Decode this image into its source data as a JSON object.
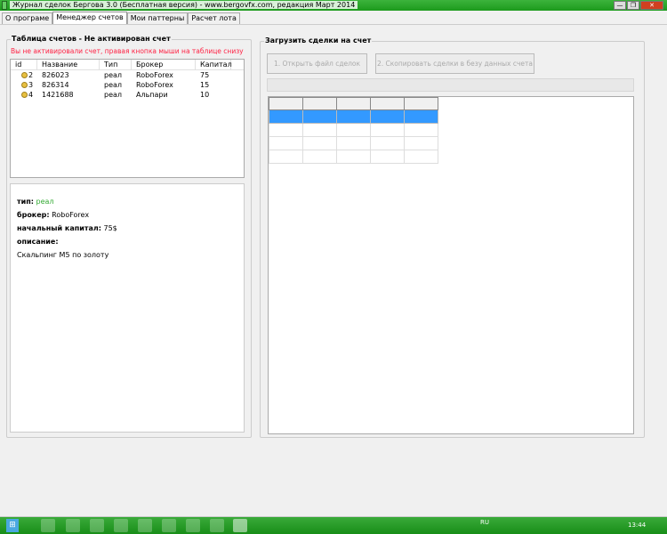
{
  "window": {
    "title": "Журнал сделок Бергова 3.0 (Бесплатная версия)  - www.bergovfx.com, редакция Март 2014",
    "min": "—",
    "max": "❐",
    "close": "✕"
  },
  "tabs": [
    {
      "label": "О програме"
    },
    {
      "label": "Менеджер счетов",
      "active": true
    },
    {
      "label": "Мои паттерны"
    },
    {
      "label": "Расчет лота"
    }
  ],
  "accounts": {
    "legend": "Таблица счетов - Не активирован счет",
    "warning": "Вы не активировали счет, правая кнопка мыши на таблице снизу",
    "columns": [
      "id",
      "Название",
      "Тип",
      "Брокер",
      "Капитал"
    ],
    "rows": [
      {
        "id": "2",
        "name": "826023",
        "type": "реал",
        "broker": "RoboForex",
        "capital": "75"
      },
      {
        "id": "3",
        "name": "826314",
        "type": "реал",
        "broker": "RoboForex",
        "capital": "15"
      },
      {
        "id": "4",
        "name": "1421688",
        "type": "реал",
        "broker": "Альпари",
        "capital": "10"
      }
    ]
  },
  "details": {
    "type_label": "тип:",
    "type_value": "реал",
    "broker_label": "брокер:",
    "broker_value": "RoboForex",
    "capital_label": "начальный капитал:",
    "capital_value": "75$",
    "desc_label": "описание:",
    "desc_value": "Скальпинг М5 по золоту"
  },
  "load": {
    "legend": "Загрузить сделки на счет",
    "open_button": "1. Открыть файл сделок",
    "copy_button": "2. Скопировать сделки в безу данных счета",
    "progress": 0
  },
  "taskbar": {
    "lang": "RU",
    "clock": "13:44"
  },
  "colors": {
    "accent": "#3399ff",
    "warning": "#ff2244",
    "type_value": "#33aa33",
    "titlebar": "#1c9a1c"
  }
}
